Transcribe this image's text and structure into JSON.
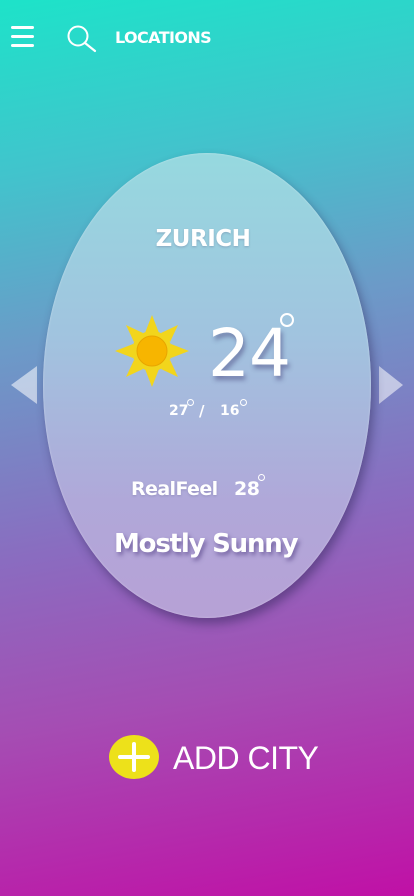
{
  "header": {
    "menu_icon": "hamburger-menu-icon",
    "search_icon": "search-icon",
    "locations_label": "LOCATIONS"
  },
  "weather": {
    "city": "ZURICH",
    "condition_icon": "sun-icon",
    "temperature": "24",
    "high": "27",
    "separator": "/",
    "low": "16",
    "realfeel_label": "RealFeel",
    "realfeel_value": "28",
    "condition": "Mostly Sunny"
  },
  "navigation": {
    "prev_icon": "chevron-left-icon",
    "next_icon": "chevron-right-icon"
  },
  "add_city": {
    "icon": "plus-icon",
    "label": "ADD CITY"
  },
  "colors": {
    "gradient_top": "#1de3c9",
    "gradient_bottom": "#c010a6",
    "accent_yellow": "#ede11a",
    "sun_yellow": "#f2d51c"
  }
}
